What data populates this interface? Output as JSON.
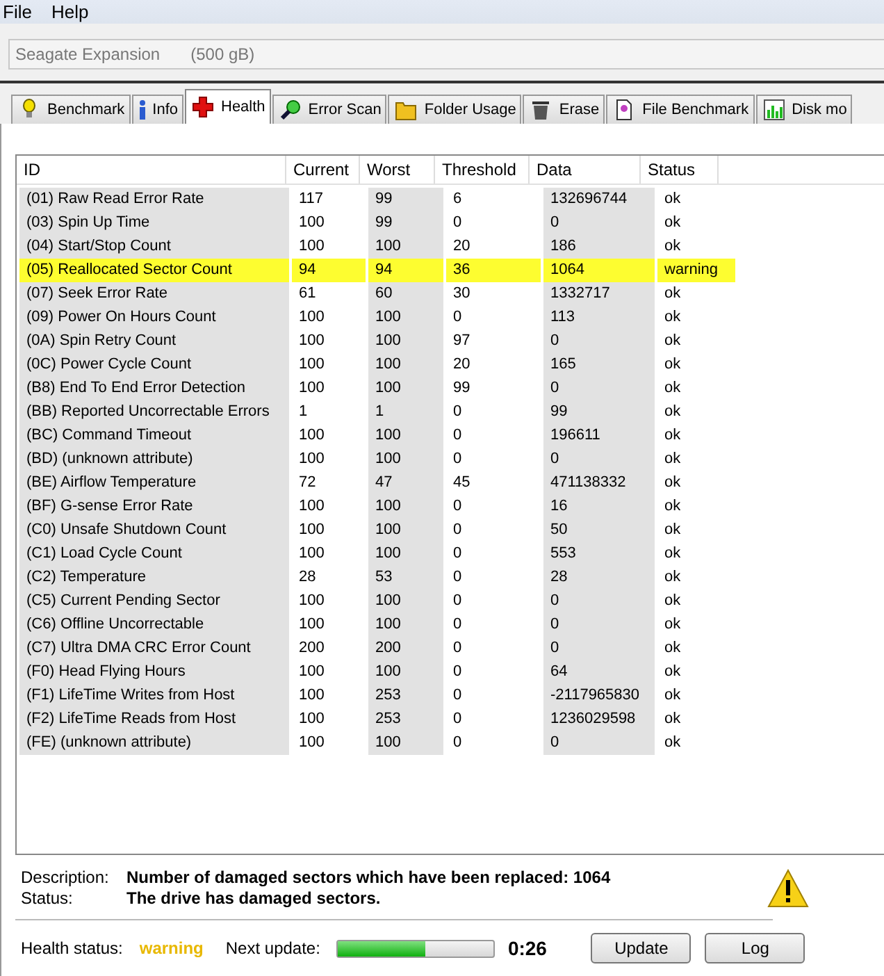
{
  "menu": [
    "File",
    "Help"
  ],
  "drive": {
    "name": "Seagate Expansion",
    "size": "(500 gB)"
  },
  "tabs": [
    {
      "label": "Benchmark",
      "kind": "bulb",
      "selected": false
    },
    {
      "label": "Info",
      "kind": "info",
      "selected": false
    },
    {
      "label": "Health",
      "kind": "cross",
      "selected": true
    },
    {
      "label": "Error Scan",
      "kind": "magnifier",
      "selected": false
    },
    {
      "label": "Folder Usage",
      "kind": "folder",
      "selected": false
    },
    {
      "label": "Erase",
      "kind": "trash",
      "selected": false
    },
    {
      "label": "File Benchmark",
      "kind": "file",
      "selected": false
    },
    {
      "label": "Disk mo",
      "kind": "chart",
      "selected": false
    }
  ],
  "table": {
    "columns": [
      "ID",
      "Current",
      "Worst",
      "Threshold",
      "Data",
      "Status"
    ],
    "rows": [
      {
        "cells": [
          "(01) Raw Read Error Rate",
          "117",
          "99",
          "6",
          "132696744",
          "ok"
        ],
        "warning": false
      },
      {
        "cells": [
          "(03) Spin Up Time",
          "100",
          "99",
          "0",
          "0",
          "ok"
        ],
        "warning": false
      },
      {
        "cells": [
          "(04) Start/Stop Count",
          "100",
          "100",
          "20",
          "186",
          "ok"
        ],
        "warning": false
      },
      {
        "cells": [
          "(05) Reallocated Sector Count",
          "94",
          "94",
          "36",
          "1064",
          "warning"
        ],
        "warning": true
      },
      {
        "cells": [
          "(07) Seek Error Rate",
          "61",
          "60",
          "30",
          "1332717",
          "ok"
        ],
        "warning": false
      },
      {
        "cells": [
          "(09) Power On Hours Count",
          "100",
          "100",
          "0",
          "113",
          "ok"
        ],
        "warning": false
      },
      {
        "cells": [
          "(0A) Spin Retry Count",
          "100",
          "100",
          "97",
          "0",
          "ok"
        ],
        "warning": false
      },
      {
        "cells": [
          "(0C) Power Cycle Count",
          "100",
          "100",
          "20",
          "165",
          "ok"
        ],
        "warning": false
      },
      {
        "cells": [
          "(B8) End To End Error Detection",
          "100",
          "100",
          "99",
          "0",
          "ok"
        ],
        "warning": false
      },
      {
        "cells": [
          "(BB) Reported Uncorrectable Errors",
          "1",
          "1",
          "0",
          "99",
          "ok"
        ],
        "warning": false
      },
      {
        "cells": [
          "(BC) Command Timeout",
          "100",
          "100",
          "0",
          "196611",
          "ok"
        ],
        "warning": false
      },
      {
        "cells": [
          "(BD) (unknown attribute)",
          "100",
          "100",
          "0",
          "0",
          "ok"
        ],
        "warning": false
      },
      {
        "cells": [
          "(BE) Airflow Temperature",
          "72",
          "47",
          "45",
          "471138332",
          "ok"
        ],
        "warning": false
      },
      {
        "cells": [
          "(BF) G-sense Error Rate",
          "100",
          "100",
          "0",
          "16",
          "ok"
        ],
        "warning": false
      },
      {
        "cells": [
          "(C0) Unsafe Shutdown Count",
          "100",
          "100",
          "0",
          "50",
          "ok"
        ],
        "warning": false
      },
      {
        "cells": [
          "(C1) Load Cycle Count",
          "100",
          "100",
          "0",
          "553",
          "ok"
        ],
        "warning": false
      },
      {
        "cells": [
          "(C2) Temperature",
          "28",
          "53",
          "0",
          "28",
          "ok"
        ],
        "warning": false
      },
      {
        "cells": [
          "(C5) Current Pending Sector",
          "100",
          "100",
          "0",
          "0",
          "ok"
        ],
        "warning": false
      },
      {
        "cells": [
          "(C6) Offline Uncorrectable",
          "100",
          "100",
          "0",
          "0",
          "ok"
        ],
        "warning": false
      },
      {
        "cells": [
          "(C7) Ultra DMA CRC Error Count",
          "200",
          "200",
          "0",
          "0",
          "ok"
        ],
        "warning": false
      },
      {
        "cells": [
          "(F0) Head Flying Hours",
          "100",
          "100",
          "0",
          "64",
          "ok"
        ],
        "warning": false
      },
      {
        "cells": [
          "(F1) LifeTime Writes from Host",
          "100",
          "253",
          "0",
          "-2117965830",
          "ok"
        ],
        "warning": false
      },
      {
        "cells": [
          "(F2) LifeTime Reads from Host",
          "100",
          "253",
          "0",
          "1236029598",
          "ok"
        ],
        "warning": false
      },
      {
        "cells": [
          "(FE) (unknown attribute)",
          "100",
          "100",
          "0",
          "0",
          "ok"
        ],
        "warning": false
      }
    ]
  },
  "details": {
    "description_label": "Description:",
    "description": "Number of damaged sectors which have been replaced: 1064",
    "status_label": "Status:",
    "status": "The drive has damaged sectors.",
    "warning": true
  },
  "footer": {
    "health_label": "Health status:",
    "health": "warning",
    "health_warning": true,
    "next_label": "Next update:",
    "progress": {
      "level": 0.56
    },
    "countdown": "0:26",
    "buttons": [
      "Update",
      "Log"
    ]
  }
}
